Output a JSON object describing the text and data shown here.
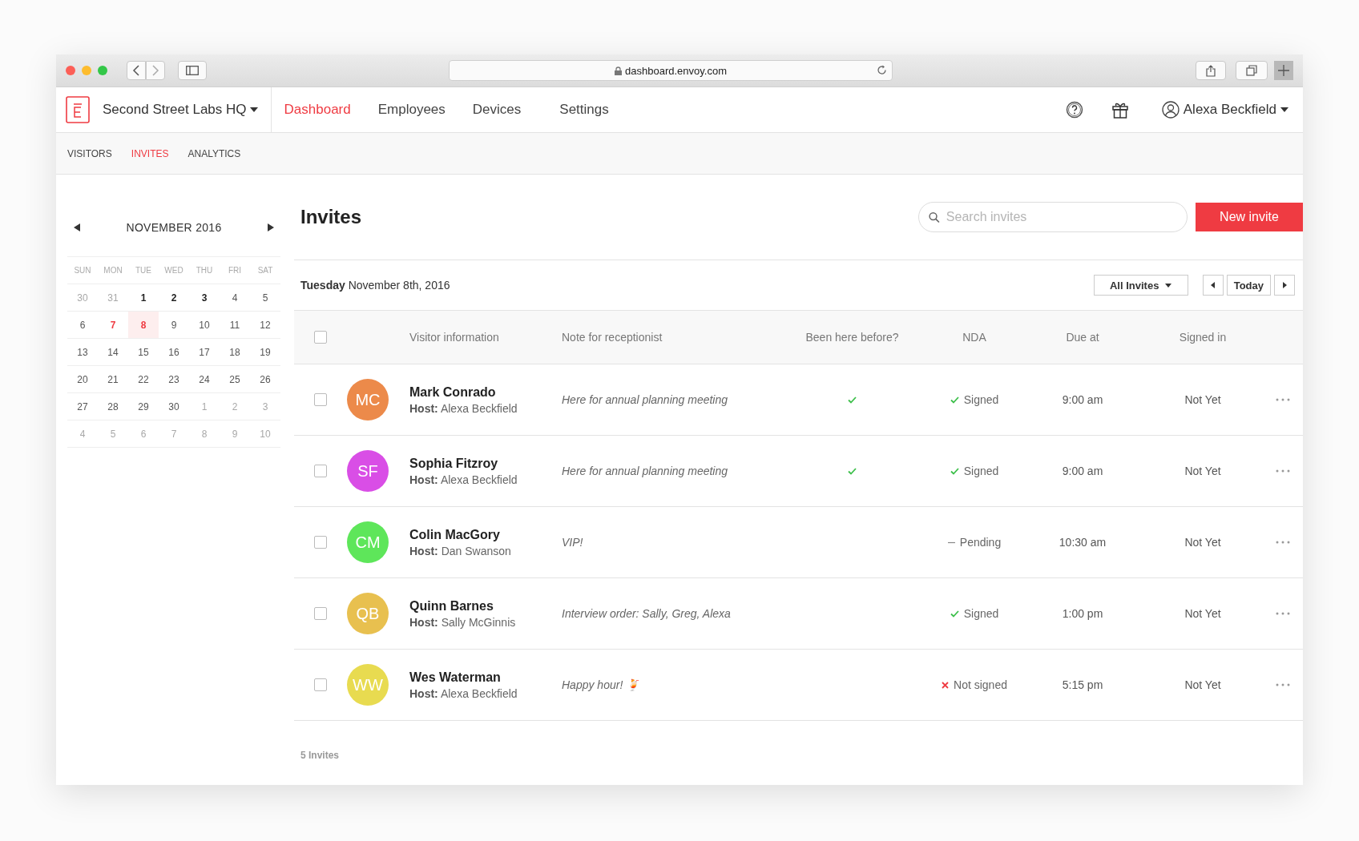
{
  "browser": {
    "url": "dashboard.envoy.com"
  },
  "nav": {
    "location": "Second Street Labs HQ",
    "items": [
      {
        "label": "Dashboard",
        "selected": true
      },
      {
        "label": "Employees",
        "selected": false
      },
      {
        "label": "Devices",
        "selected": false
      },
      {
        "label": "Settings",
        "selected": false
      }
    ],
    "user": "Alexa Beckfield"
  },
  "subnav": [
    {
      "label": "VISITORS",
      "selected": false
    },
    {
      "label": "INVITES",
      "selected": true
    },
    {
      "label": "ANALYTICS",
      "selected": false
    }
  ],
  "calendar": {
    "title": "NOVEMBER 2016",
    "weekdays": [
      "SUN",
      "MON",
      "TUE",
      "WED",
      "THU",
      "FRI",
      "SAT"
    ],
    "days": [
      {
        "label": "30",
        "kind": "other",
        "selected": false
      },
      {
        "label": "31",
        "kind": "other",
        "selected": false
      },
      {
        "label": "1",
        "kind": "event",
        "selected": false
      },
      {
        "label": "2",
        "kind": "event",
        "selected": false
      },
      {
        "label": "3",
        "kind": "event",
        "selected": false
      },
      {
        "label": "4",
        "kind": "normal",
        "selected": false
      },
      {
        "label": "5",
        "kind": "normal",
        "selected": false
      },
      {
        "label": "6",
        "kind": "normal",
        "selected": false
      },
      {
        "label": "7",
        "kind": "today",
        "selected": false
      },
      {
        "label": "8",
        "kind": "today",
        "selected": true
      },
      {
        "label": "9",
        "kind": "normal",
        "selected": false
      },
      {
        "label": "10",
        "kind": "normal",
        "selected": false
      },
      {
        "label": "11",
        "kind": "normal",
        "selected": false
      },
      {
        "label": "12",
        "kind": "normal",
        "selected": false
      },
      {
        "label": "13",
        "kind": "normal",
        "selected": false
      },
      {
        "label": "14",
        "kind": "normal",
        "selected": false
      },
      {
        "label": "15",
        "kind": "normal",
        "selected": false
      },
      {
        "label": "16",
        "kind": "normal",
        "selected": false
      },
      {
        "label": "17",
        "kind": "normal",
        "selected": false
      },
      {
        "label": "18",
        "kind": "normal",
        "selected": false
      },
      {
        "label": "19",
        "kind": "normal",
        "selected": false
      },
      {
        "label": "20",
        "kind": "normal",
        "selected": false
      },
      {
        "label": "21",
        "kind": "normal",
        "selected": false
      },
      {
        "label": "22",
        "kind": "normal",
        "selected": false
      },
      {
        "label": "23",
        "kind": "normal",
        "selected": false
      },
      {
        "label": "24",
        "kind": "normal",
        "selected": false
      },
      {
        "label": "25",
        "kind": "normal",
        "selected": false
      },
      {
        "label": "26",
        "kind": "normal",
        "selected": false
      },
      {
        "label": "27",
        "kind": "normal",
        "selected": false
      },
      {
        "label": "28",
        "kind": "normal",
        "selected": false
      },
      {
        "label": "29",
        "kind": "normal",
        "selected": false
      },
      {
        "label": "30",
        "kind": "normal",
        "selected": false
      },
      {
        "label": "1",
        "kind": "other",
        "selected": false
      },
      {
        "label": "2",
        "kind": "other",
        "selected": false
      },
      {
        "label": "3",
        "kind": "other",
        "selected": false
      },
      {
        "label": "4",
        "kind": "other",
        "selected": false
      },
      {
        "label": "5",
        "kind": "other",
        "selected": false
      },
      {
        "label": "6",
        "kind": "other",
        "selected": false
      },
      {
        "label": "7",
        "kind": "other",
        "selected": false
      },
      {
        "label": "8",
        "kind": "other",
        "selected": false
      },
      {
        "label": "9",
        "kind": "other",
        "selected": false
      },
      {
        "label": "10",
        "kind": "other",
        "selected": false
      }
    ]
  },
  "page": {
    "title": "Invites",
    "search": {
      "placeholder": "Search invites"
    },
    "new_button": "New invite"
  },
  "date_bar": {
    "date": "**Tuesday** November 8th, 2016",
    "filter": "All Invites",
    "today_button": "Today"
  },
  "table": {
    "columns": [
      "Visitor information",
      "Note for receptionist",
      "Been here before?",
      "NDA",
      "Due at",
      "Signed in"
    ],
    "header_checked": false,
    "rows": [
      {
        "checked": false,
        "initials": "MC",
        "color": "#ec8a4a",
        "name": "Mark Conrado",
        "host": "**Host:** Alexa Beckfield",
        "note": "Here for annual planning meeting",
        "been_here": true,
        "nda": {
          "kind": "signed",
          "label": "Signed"
        },
        "due": "9:00 am",
        "signed_in": "Not Yet"
      },
      {
        "checked": false,
        "initials": "SF",
        "color": "#d94ee6",
        "name": "Sophia Fitzroy",
        "host": "**Host:** Alexa Beckfield",
        "note": "Here for annual planning meeting",
        "been_here": true,
        "nda": {
          "kind": "signed",
          "label": "Signed"
        },
        "due": "9:00 am",
        "signed_in": "Not Yet"
      },
      {
        "checked": false,
        "initials": "CM",
        "color": "#5ee65a",
        "name": "Colin MacGory",
        "host": "**Host:** Dan Swanson",
        "note": "VIP!",
        "been_here": false,
        "nda": {
          "kind": "pending",
          "label": "Pending"
        },
        "due": "10:30 am",
        "signed_in": "Not Yet"
      },
      {
        "checked": false,
        "initials": "QB",
        "color": "#e8c04f",
        "name": "Quinn Barnes",
        "host": "**Host:** Sally McGinnis",
        "note": "Interview order: Sally, Greg, Alexa",
        "been_here": false,
        "nda": {
          "kind": "signed",
          "label": "Signed"
        },
        "due": "1:00 pm",
        "signed_in": "Not Yet"
      },
      {
        "checked": false,
        "initials": "WW",
        "color": "#e8db50",
        "name": "Wes Waterman",
        "host": "**Host:** Alexa Beckfield",
        "note": "Happy hour! 🍹",
        "been_here": false,
        "nda": {
          "kind": "not_signed",
          "label": "Not signed"
        },
        "due": "5:15 pm",
        "signed_in": "Not Yet"
      }
    ],
    "footer": "5 Invites"
  }
}
